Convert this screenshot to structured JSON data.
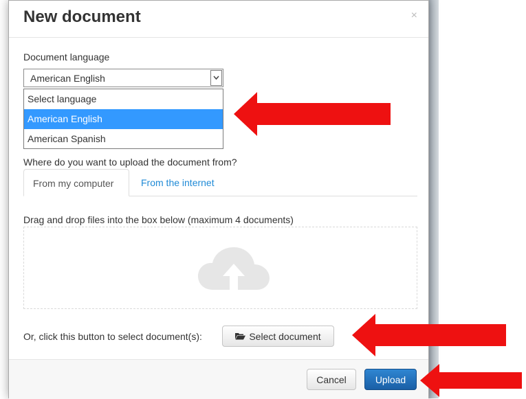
{
  "dialog": {
    "title": "New document",
    "close_label": "×"
  },
  "language": {
    "label": "Document language",
    "selected": "American English",
    "options": [
      {
        "label": "Select language",
        "selected": false
      },
      {
        "label": "American English",
        "selected": true
      },
      {
        "label": "American Spanish",
        "selected": false
      }
    ]
  },
  "upload": {
    "question": "Where do you want to upload the document from?",
    "tabs": [
      {
        "label": "From my computer",
        "active": true
      },
      {
        "label": "From the internet",
        "active": false
      }
    ],
    "dropzone_label": "Drag and drop files into the box below (maximum 4 documents)",
    "select_prompt": "Or, click this button to select document(s):",
    "select_button": "Select document"
  },
  "footer": {
    "cancel_label": "Cancel",
    "upload_label": "Upload"
  },
  "colors": {
    "primary": "#1f6fbf",
    "selection": "#3399ff",
    "link": "#1f8ad6",
    "annotation_arrow": "#ee1111"
  },
  "icons": [
    "close-icon",
    "chevron-down-icon",
    "cloud-upload-icon",
    "folder-open-icon",
    "red-arrow-icon"
  ]
}
